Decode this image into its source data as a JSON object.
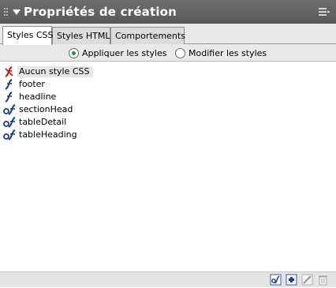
{
  "panel": {
    "title": "Propriétés de création"
  },
  "tabs": [
    {
      "label": "Styles CSS",
      "active": true
    },
    {
      "label": "Styles HTML",
      "active": false
    },
    {
      "label": "Comportements",
      "active": false
    }
  ],
  "mode": {
    "apply_label": "Appliquer les styles",
    "edit_label": "Modifier les styles",
    "selected": "apply"
  },
  "styles": [
    {
      "label": "Aucun style CSS",
      "icon": "no-style-icon",
      "selected": true
    },
    {
      "label": "footer",
      "icon": "css-style-icon"
    },
    {
      "label": "headline",
      "icon": "css-style-icon"
    },
    {
      "label": "sectionHead",
      "icon": "linked-css-style-icon"
    },
    {
      "label": "tableDetail",
      "icon": "linked-css-style-icon"
    },
    {
      "label": "tableHeading",
      "icon": "linked-css-style-icon"
    }
  ],
  "bottom_buttons": [
    "attach-stylesheet-icon",
    "new-style-icon",
    "edit-style-icon",
    "delete-style-icon"
  ],
  "colors": {
    "title_bar": "#585858",
    "radio_selected": "#1a9a2a",
    "icon_red": "#cc1111",
    "icon_blue": "#1c3a8a"
  }
}
